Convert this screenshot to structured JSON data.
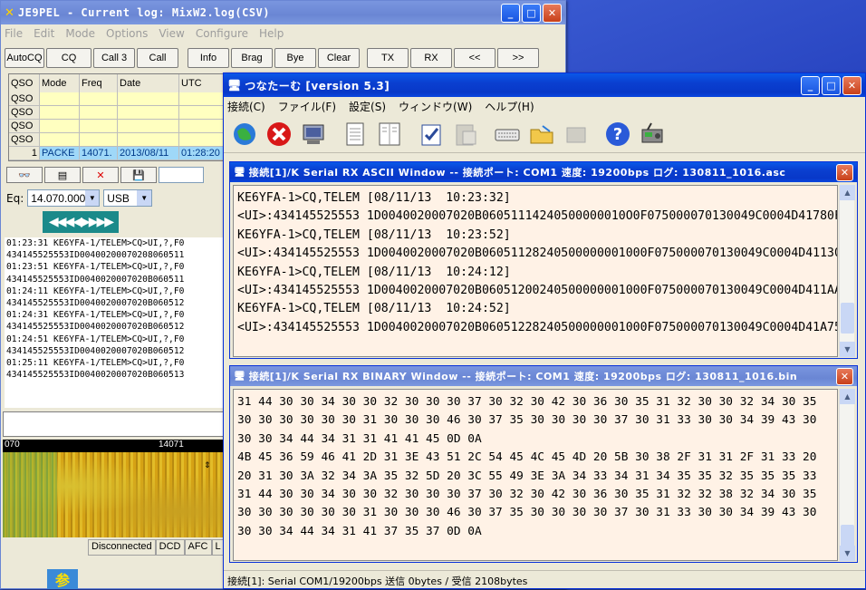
{
  "log_window": {
    "title": "JE9PEL - Current log: MixW2.log(CSV)",
    "menu": [
      "File",
      "Edit",
      "Mode",
      "Options",
      "View",
      "Configure",
      "Help"
    ],
    "buttons": [
      "AutoCQ",
      "CQ",
      "Call 3",
      "Call",
      "Info",
      "Brag",
      "Bye",
      "Clear",
      "TX",
      "RX",
      "<<",
      ">>"
    ],
    "grid": {
      "headers": [
        "QSO",
        "Mode",
        "Freq",
        "Date",
        "UTC"
      ],
      "empty_rows": [
        "QSO",
        "QSO",
        "QSO",
        "QSO"
      ],
      "selected_row": [
        "1",
        "PACKE",
        "14071.",
        "2013/08/11",
        "01:28:20"
      ]
    },
    "freq_label": "Eq:",
    "freq_value": "14.070.000",
    "mode_value": "USB",
    "tuner_glyphs": "◀◀◀◀▶▶▶▶",
    "log_lines": [
      "01:23:31 KE6YFA-1/TELEM>CQ>UI,?,F0",
      "434145525553ID00400200070208060511",
      "01:23:51 KE6YFA-1/TELEM>CQ>UI,?,F0",
      "434145525553ID0040020007020B060511",
      "01:24:11 KE6YFA-1/TELEM>CQ>UI,?,F0",
      "434145525553ID0040020007020B060512",
      "01:24:31 KE6YFA-1/TELEM>CQ>UI,?,F0",
      "434145525553ID0040020007020B060512",
      "01:24:51 KE6YFA-1/TELEM>CQ>UI,?,F0",
      "434145525553ID0040020007020B060512",
      "01:25:11 KE6YFA-1/TELEM>CQ>UI,?,F0",
      "434145525553ID0040020007020B060513"
    ],
    "scale_left": "070",
    "scale_mid": "14071",
    "status": [
      "Disconnected",
      "DCD",
      "AFC",
      "L"
    ]
  },
  "tn_window": {
    "title": "つなたーむ [version 5.3]",
    "menu": [
      "接続(C)",
      "ファイル(F)",
      "設定(S)",
      "ウィンドウ(W)",
      "ヘルプ(H)"
    ],
    "ascii_window": {
      "title": "接続[1]/K Serial RX ASCII Window -- 接続ポート: COM1 速度: 19200bps ログ: 130811_1016.asc",
      "lines": [
        "KE6YFA-1>CQ,TELEM [08/11/13  10:23:32]",
        "<UI>:434145525553 1D0040020007020B06051114240500000010O0F075000070130049C0004D41780F",
        "KE6YFA-1>CQ,TELEM [08/11/13  10:23:52]",
        "<UI>:434145525553 1D0040020007020B06051128240500000001000F075000070130049C0004D41130E",
        "KE6YFA-1>CQ,TELEM [08/11/13  10:24:12]",
        "<UI>:434145525553 1D0040020007020B06051200240500000001000F075000070130049C0004D411AAE",
        "KE6YFA-1>CQ,TELEM [08/11/13  10:24:52]",
        "<UI>:434145525553 1D0040020007020B06051228240500000001000F075000070130049C0004D41A757"
      ]
    },
    "binary_window": {
      "title": "接続[1]/K Serial RX BINARY Window -- 接続ポート: COM1 速度: 19200bps ログ: 130811_1016.bin",
      "lines": [
        "31 44 30 30 34 30 30 32 30 30 30 37 30 32 30 42 30 36 30 35 31 32 30 30 32 34 30 35",
        "30 30 30 30 30 30 31 30 30 30 46 30 37 35 30 30 30 30 37 30 31 33 30 30 34 39 43 30",
        "30 30 34 44 34 31 31 41 41 45 0D 0A",
        "4B 45 36 59 46 41 2D 31 3E 43 51 2C 54 45 4C 45 4D 20 5B 30 38 2F 31 31 2F 31 33 20",
        "20 31 30 3A 32 34 3A 35 32 5D 20 3C 55 49 3E 3A 34 33 34 31 34 35 35 32 35 35 35 33",
        "31 44 30 30 34 30 30 32 30 30 30 37 30 32 30 42 30 36 30 35 31 32 32 38 32 34 30 35",
        "30 30 30 30 30 30 31 30 30 30 46 30 37 35 30 30 30 30 37 30 31 33 30 30 34 39 43 30",
        "30 30 34 44 34 31 41 37 35 37 0D 0A"
      ]
    },
    "status": "接続[1]: Serial COM1/19200bps 送信 0bytes / 受信 2108bytes"
  },
  "taskbar_glyph": "参"
}
